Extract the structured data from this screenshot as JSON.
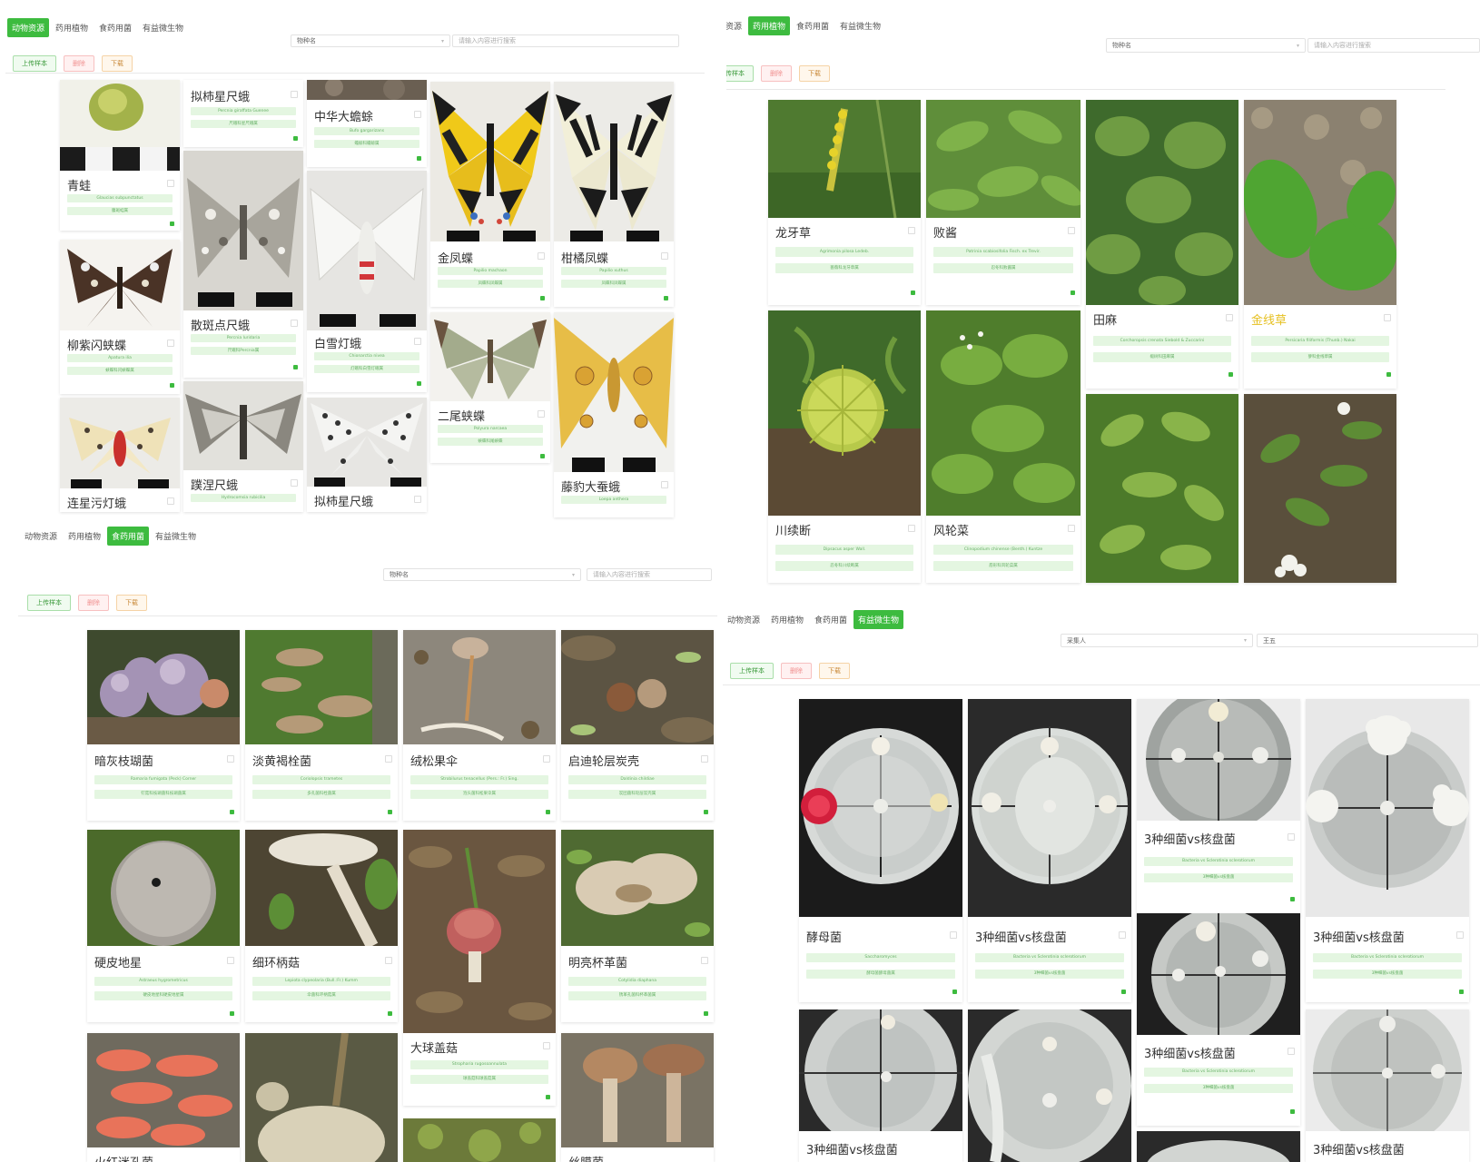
{
  "tabs": [
    "动物资源",
    "药用植物",
    "食药用菌",
    "有益微生物"
  ],
  "buttons": {
    "upload": "上传样本",
    "delete": "删除",
    "download": "下载"
  },
  "panels": {
    "animals": {
      "active_tab": "动物资源",
      "filter_select": "物种名",
      "search_placeholder": "请输入内容进行搜索",
      "cards": [
        {
          "name": "青蛙",
          "latin": "Glaucias subpunctatus",
          "sub": "腹斑蛙属"
        },
        {
          "name": "柳紫闪蛱蝶",
          "latin": "Apatura ilia",
          "sub": "蛱蝶科闪蛱蝶属"
        },
        {
          "name": "连星污灯蛾",
          "latin": "",
          "sub": ""
        },
        {
          "name": "拟柿星尺蛾",
          "latin": "Percnia giraffata Guenee",
          "sub": "尺蛾科星尺蛾属"
        },
        {
          "name": "散斑点尺蛾",
          "latin": "Percnia luridaria",
          "sub": "尺蛾科Percnia属"
        },
        {
          "name": "蹼涅尺蛾",
          "latin": "Hydrocomsia rubicilia",
          "sub": ""
        },
        {
          "name": "中华大蟾蜍",
          "latin": "Bufo gargarizans",
          "sub": "蟾蜍科蟾蜍属"
        },
        {
          "name": "白雪灯蛾",
          "latin": "Chionarctia nivea",
          "sub": "灯蛾科白雪灯蛾属"
        },
        {
          "name": "拟柿星尺蛾",
          "latin": "",
          "sub": ""
        },
        {
          "name": "金凤蝶",
          "latin": "Papilio machaon",
          "sub": "凤蝶科凤蝶属"
        },
        {
          "name": "二尾蛱蝶",
          "latin": "Polyura narcaea",
          "sub": "蛱蝶科尾蛱蝶"
        },
        {
          "name": "柑橘凤蝶",
          "latin": "Papilio xuthus",
          "sub": "凤蝶科凤蝶属"
        },
        {
          "name": "藤豹大蚕蛾",
          "latin": "Loepa anthera",
          "sub": ""
        }
      ]
    },
    "plants": {
      "active_tab": "药用植物",
      "filter_select": "物种名",
      "search_placeholder": "请输入内容进行搜索",
      "cards": [
        {
          "name": "龙牙草",
          "latin": "Agrimonia pilosa Ledeb.",
          "sub": "蔷薇科龙牙草属"
        },
        {
          "name": "川续断",
          "latin": "Dipsacus asper Wall.",
          "sub": "忍冬科川续断属"
        },
        {
          "name": "败酱",
          "latin": "Patrinia scabiosifolia Fisch. ex Trevir.",
          "sub": "忍冬科败酱属"
        },
        {
          "name": "风轮菜",
          "latin": "Clinopodium chinense (Benth.) Kuntze",
          "sub": "唇形科风轮菜属"
        },
        {
          "name": "田麻",
          "latin": "Corchoropsis crenata Siebold & Zuccarini",
          "sub": "椴树科田麻属"
        },
        {
          "name": "金线草",
          "latin": "Persicaria filiformis (Thunb.) Nakai",
          "sub": "蓼科金线草属"
        }
      ]
    },
    "fungi": {
      "active_tab": "食药用菌",
      "filter_select": "物种名",
      "search_placeholder": "请输入内容进行搜索",
      "cards": [
        {
          "name": "暗灰枝瑚菌",
          "latin": "Ramaria fumigata (Peck) Corner",
          "sub": "钉菇科枝瑚菌科枝瑚菌属"
        },
        {
          "name": "硬皮地星",
          "latin": "Astraeus hygrometricus",
          "sub": "硬皮地星科硬皮地星属"
        },
        {
          "name": "火红迷孔菌",
          "latin": "",
          "sub": ""
        },
        {
          "name": "淡黄褐栓菌",
          "latin": "Coriolopsis trametes",
          "sub": "多孔菌科栓菌属"
        },
        {
          "name": "细环柄菇",
          "latin": "Lepiota clypeolaria (Bull.:Fr.) Kumm",
          "sub": "伞菌科环柄菇属"
        },
        {
          "name": "绒松果伞",
          "latin": "Strobilurus tenacellus (Pers.: Fr.) Sing.",
          "sub": "泡头菌科松果伞属"
        },
        {
          "name": "大球盖菇",
          "latin": "Stropharia rugosoannulata",
          "sub": "球盖菇科球盖菇属"
        },
        {
          "name": "启迪轮层炭壳",
          "latin": "Daldinia childiae",
          "sub": "炭团菌科轮层炭壳属"
        },
        {
          "name": "明亮杯革菌",
          "latin": "Cotylidia diaphana",
          "sub": "锈革孔菌科杯革菌属"
        },
        {
          "name": "丝膜菌",
          "latin": "",
          "sub": ""
        }
      ]
    },
    "microbes": {
      "active_tab": "有益微生物",
      "filter_select": "采集人",
      "search_value": "王五",
      "cards": [
        {
          "name": "酵母菌",
          "latin": "Saccharomyces",
          "sub": "酵母菌酵母菌属"
        },
        {
          "name": "3种细菌vs核盘菌",
          "latin": "",
          "sub": ""
        },
        {
          "name": "3种细菌vs核盘菌",
          "latin": "Bacteria vs Sclerotinia sclerotiorum",
          "sub": "3种细菌vs核盘菌"
        },
        {
          "name": "3种细菌vs核盘菌",
          "latin": "Bacteria vs Sclerotinia sclerotiorum",
          "sub": "3种细菌vs核盘菌"
        },
        {
          "name": "3种细菌vs核盘菌",
          "latin": "Bacteria vs Sclerotinia sclerotiorum",
          "sub": "3种细菌vs核盘菌"
        },
        {
          "name": "3种细菌vs核盘菌",
          "latin": "Bacteria vs Sclerotinia sclerotiorum",
          "sub": "3种细菌vs核盘菌"
        },
        {
          "name": "3种细菌vs核盘菌",
          "latin": "",
          "sub": ""
        }
      ]
    }
  },
  "colors": {
    "accent": "#3dbb3f",
    "pill_bg": "#e4f6e1",
    "highlight_name": "#e6c020"
  }
}
